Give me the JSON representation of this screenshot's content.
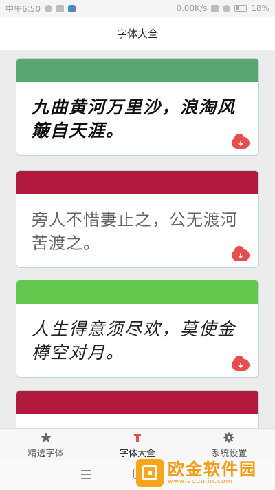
{
  "status_bar": {
    "time": "中午6:50",
    "speed": "0.00K/s",
    "battery": "18%"
  },
  "title": "字体大全",
  "cards": [
    {
      "text": "九曲黄河万里沙，浪淘风簸自天涯。",
      "header_color": "#5ba571"
    },
    {
      "text": "旁人不惜妻止之，公无渡河苦渡之。",
      "header_color": "#b3193f"
    },
    {
      "text": "人生得意须尽欢，莫使金樽空对月。",
      "header_color": "#64c74d"
    },
    {
      "header_color": "#b3193f"
    }
  ],
  "tabs": [
    {
      "label": "精选字体",
      "icon": "star-icon"
    },
    {
      "label": "字体大全",
      "icon": "t-font-icon"
    },
    {
      "label": "系统设置",
      "icon": "gear-icon"
    }
  ],
  "watermark": {
    "main": "欧金软件园",
    "sub": "www.apoujin.com"
  },
  "colors": {
    "accent": "#e84d4d",
    "background": "#ececec"
  }
}
